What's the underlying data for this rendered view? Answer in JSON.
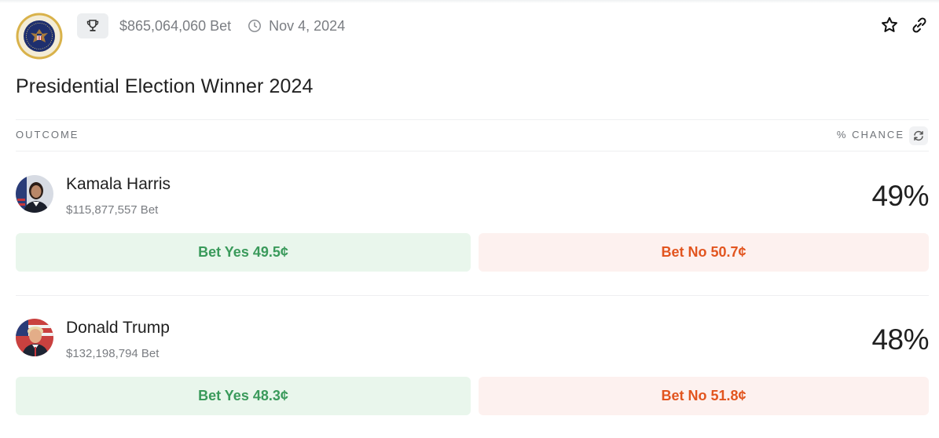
{
  "market": {
    "volume": "$865,064,060 Bet",
    "date": "Nov 4, 2024",
    "title": "Presidential Election Winner 2024",
    "icons": {
      "seal": "presidential-seal-icon",
      "trophy": "trophy-icon",
      "clock": "clock-icon",
      "favorite": "star-icon",
      "share": "link-icon"
    }
  },
  "table": {
    "outcome_header": "OUTCOME",
    "chance_header": "% CHANCE",
    "refresh_icon": "refresh-icon"
  },
  "outcomes": [
    {
      "name": "Kamala Harris",
      "volume": "$115,877,557 Bet",
      "chance": "49%",
      "yes_label": "Bet Yes 49.5¢",
      "no_label": "Bet No 50.7¢"
    },
    {
      "name": "Donald Trump",
      "volume": "$132,198,794 Bet",
      "chance": "48%",
      "yes_label": "Bet Yes 48.3¢",
      "no_label": "Bet No 51.8¢"
    }
  ],
  "colors": {
    "yes_text": "#3a9a5b",
    "yes_bg": "#e9f6ec",
    "no_text": "#e2551f",
    "no_bg": "#fdf1ef"
  }
}
